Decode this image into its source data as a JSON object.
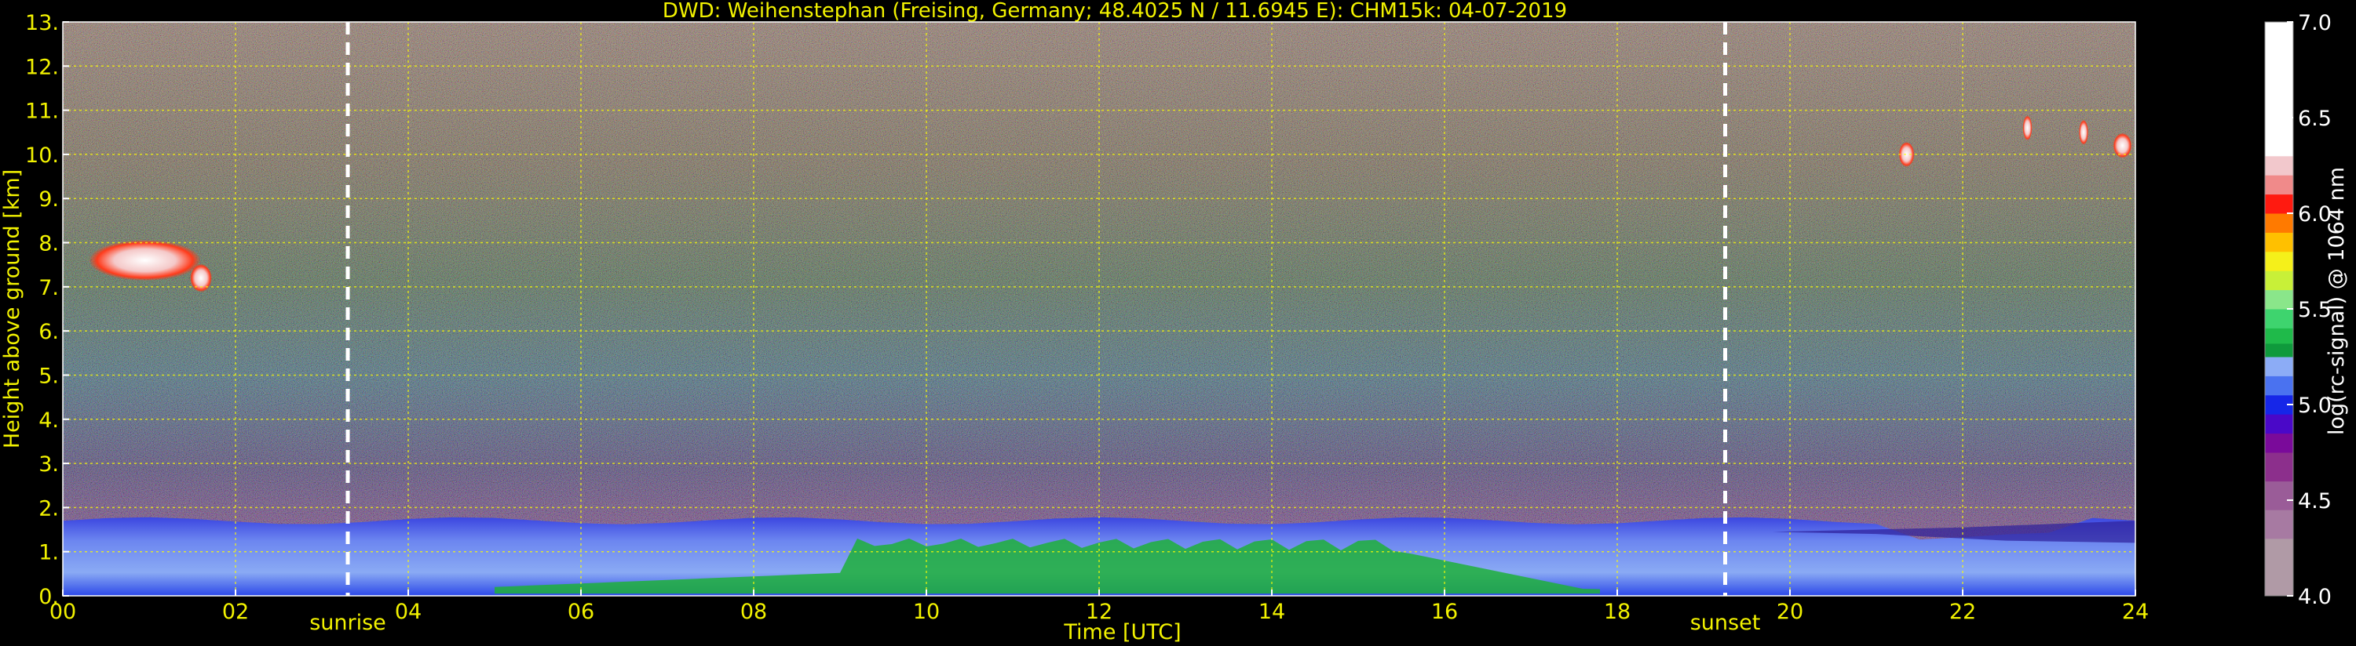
{
  "chart_data": {
    "type": "heatmap",
    "title": "DWD: Weihenstephan (Freising, Germany; 48.4025 N / 11.6945 E):    CHM15k: 04-07-2019",
    "xlabel": "Time [UTC]",
    "ylabel": "Height above ground [km]",
    "xlim": [
      0,
      24
    ],
    "ylim": [
      0,
      13
    ],
    "x_ticks": [
      "00",
      "02",
      "04",
      "06",
      "08",
      "10",
      "12",
      "14",
      "16",
      "18",
      "20",
      "22",
      "24"
    ],
    "y_ticks": [
      "0.",
      "1.",
      "2.",
      "3.",
      "4.",
      "5.",
      "6.",
      "7.",
      "8.",
      "9.",
      "10.",
      "11.",
      "12.",
      "13."
    ],
    "grid": true,
    "grid_color": "#ffff00",
    "events": [
      {
        "label": "sunrise",
        "time": 3.3
      },
      {
        "label": "sunset",
        "time": 19.25
      }
    ],
    "colorbar": {
      "label": "log(rc-signal) @ 1064 nm",
      "range": [
        4.0,
        7.0
      ],
      "tick_values": [
        4.0,
        4.5,
        5.0,
        5.5,
        6.0,
        6.5,
        7.0
      ],
      "tick_labels": [
        "4.0",
        "4.5",
        "5.0",
        "5.5",
        "6.0",
        "6.5",
        "7.0"
      ],
      "colors": [
        {
          "from": 4.0,
          "to": 4.3,
          "color": "#b09aa6"
        },
        {
          "from": 4.3,
          "to": 4.45,
          "color": "#a77aa2"
        },
        {
          "from": 4.45,
          "to": 4.6,
          "color": "#9a5c98"
        },
        {
          "from": 4.6,
          "to": 4.75,
          "color": "#8c2f8c"
        },
        {
          "from": 4.75,
          "to": 4.85,
          "color": "#7a0a9a"
        },
        {
          "from": 4.85,
          "to": 4.95,
          "color": "#4a08c8"
        },
        {
          "from": 4.95,
          "to": 5.05,
          "color": "#1626e8"
        },
        {
          "from": 5.05,
          "to": 5.15,
          "color": "#4a72f0"
        },
        {
          "from": 5.15,
          "to": 5.25,
          "color": "#8cacf6"
        },
        {
          "from": 5.25,
          "to": 5.32,
          "color": "#0f9a3c"
        },
        {
          "from": 5.32,
          "to": 5.4,
          "color": "#1fba4a"
        },
        {
          "from": 5.4,
          "to": 5.5,
          "color": "#3ed46e"
        },
        {
          "from": 5.5,
          "to": 5.6,
          "color": "#8ae68a"
        },
        {
          "from": 5.6,
          "to": 5.7,
          "color": "#c8f038"
        },
        {
          "from": 5.7,
          "to": 5.8,
          "color": "#f5f01a"
        },
        {
          "from": 5.8,
          "to": 5.9,
          "color": "#ffc000"
        },
        {
          "from": 5.9,
          "to": 6.0,
          "color": "#ff7a00"
        },
        {
          "from": 6.0,
          "to": 6.1,
          "color": "#ff1a10"
        },
        {
          "from": 6.1,
          "to": 6.2,
          "color": "#f08a8a"
        },
        {
          "from": 6.2,
          "to": 6.3,
          "color": "#f2c8cc"
        },
        {
          "from": 6.3,
          "to": 7.0,
          "color": "#ffffff"
        }
      ]
    },
    "features": {
      "boundary_layer_top_km": 1.7,
      "cloud_early": {
        "time_start": 0.3,
        "time_end": 1.6,
        "height_km": 7.6
      },
      "cloud_late": {
        "time_start": 21.1,
        "time_end": 24.0,
        "height_km": 10.2
      }
    }
  }
}
